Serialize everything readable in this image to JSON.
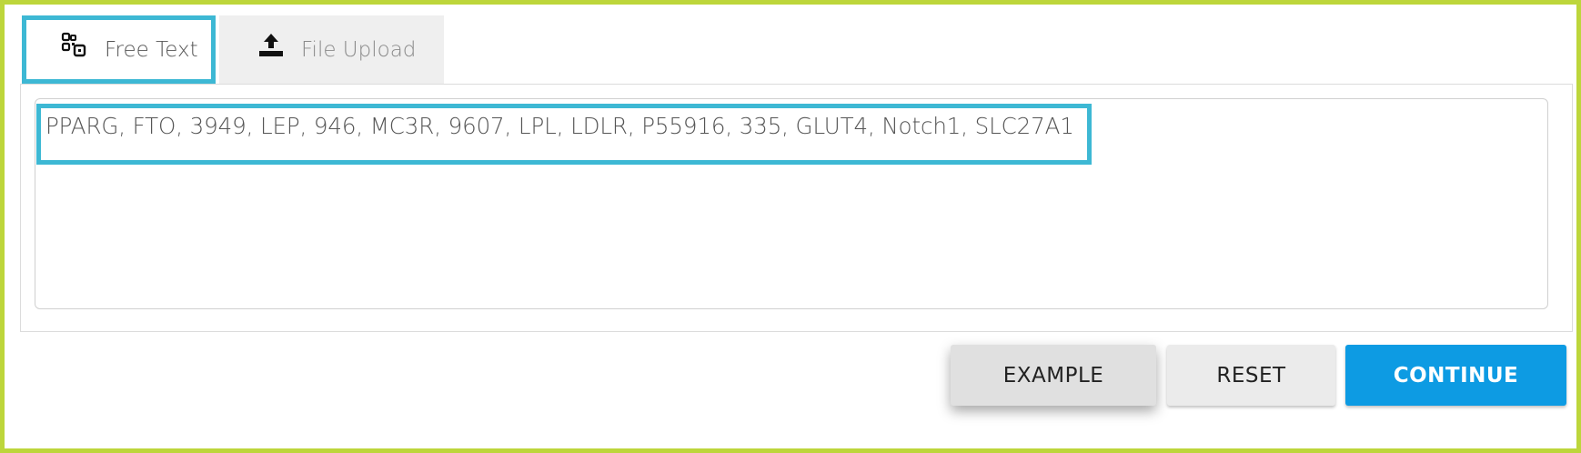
{
  "tabs": {
    "free_text": {
      "label": "Free Text",
      "icon": "qr-code-icon"
    },
    "file_upload": {
      "label": "File Upload",
      "icon": "upload-icon"
    }
  },
  "input": {
    "value": "PPARG, FTO, 3949, LEP, 946, MC3R, 9607, LPL, LDLR, P55916, 335, GLUT4, Notch1, SLC27A1"
  },
  "buttons": {
    "example": "EXAMPLE",
    "reset": "RESET",
    "continue": "CONTINUE"
  },
  "colors": {
    "frame_border": "#bdd63b",
    "highlight": "#3db8d4",
    "primary": "#0d9be3"
  }
}
